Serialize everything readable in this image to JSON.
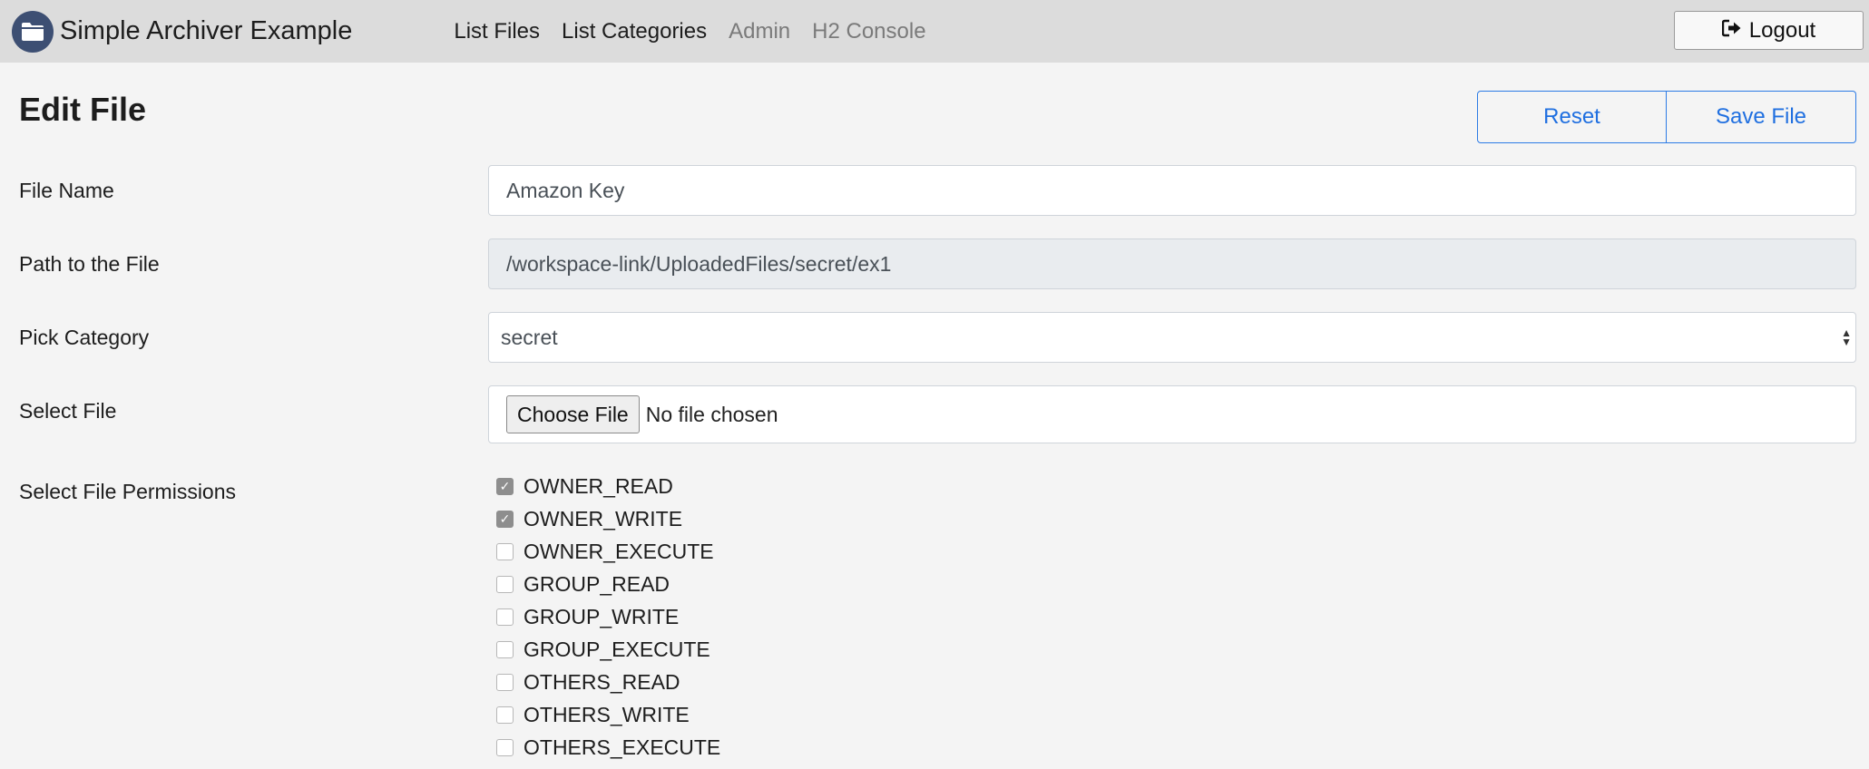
{
  "navbar": {
    "brand_title": "Simple Archiver Example",
    "brand_icon": "folder-icon",
    "links": [
      "List Files",
      "List Categories",
      "Admin",
      "H2 Console"
    ],
    "logout_label": "Logout",
    "logout_icon": "sign-out-icon"
  },
  "page": {
    "title": "Edit File",
    "reset_label": "Reset",
    "save_label": "Save File",
    "accent_color": "#1f6fe0"
  },
  "form": {
    "file_name": {
      "label": "File Name",
      "value": "Amazon Key"
    },
    "path": {
      "label": "Path to the File",
      "value": "/workspace-link/UploadedFiles/secret/ex1"
    },
    "category": {
      "label": "Pick Category",
      "value": "secret"
    },
    "file": {
      "label": "Select File",
      "button_label": "Choose File",
      "status": "No file chosen"
    },
    "permissions": {
      "label": "Select File Permissions",
      "items": [
        {
          "label": "OWNER_READ",
          "checked": true
        },
        {
          "label": "OWNER_WRITE",
          "checked": true
        },
        {
          "label": "OWNER_EXECUTE",
          "checked": false
        },
        {
          "label": "GROUP_READ",
          "checked": false
        },
        {
          "label": "GROUP_WRITE",
          "checked": false
        },
        {
          "label": "GROUP_EXECUTE",
          "checked": false
        },
        {
          "label": "OTHERS_READ",
          "checked": false
        },
        {
          "label": "OTHERS_WRITE",
          "checked": false
        },
        {
          "label": "OTHERS_EXECUTE",
          "checked": false
        }
      ]
    }
  }
}
